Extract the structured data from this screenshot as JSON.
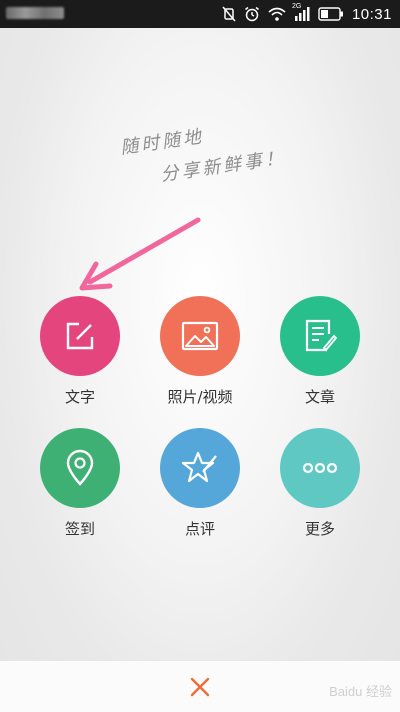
{
  "status_bar": {
    "time": "10:31",
    "network_tag": "2G",
    "icons": [
      "mute-icon",
      "alarm-icon",
      "wifi-icon",
      "signal-icon",
      "battery-icon"
    ]
  },
  "slogan": {
    "line1": "随时随地",
    "line2": "分享新鲜事！"
  },
  "actions": [
    {
      "label": "文字",
      "icon": "compose-icon",
      "color": "#e5457d"
    },
    {
      "label": "照片/视频",
      "icon": "photo-icon",
      "color": "#f07058"
    },
    {
      "label": "文章",
      "icon": "article-icon",
      "color": "#29bf8d"
    },
    {
      "label": "签到",
      "icon": "location-icon",
      "color": "#3fb074"
    },
    {
      "label": "点评",
      "icon": "review-star-icon",
      "color": "#55a7da"
    },
    {
      "label": "更多",
      "icon": "more-icon",
      "color": "#5fc8c3"
    }
  ],
  "arrow_color": "#f2679b",
  "watermark": "Baidu 经验"
}
